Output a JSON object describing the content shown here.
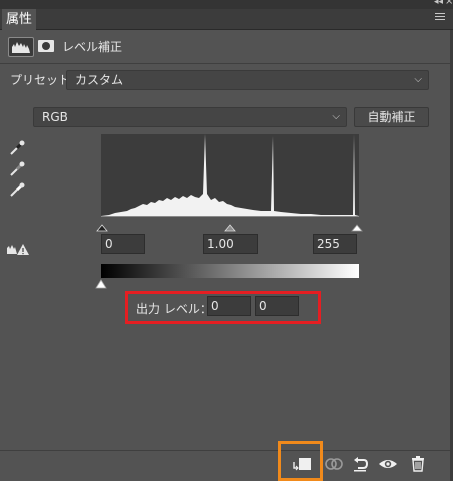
{
  "panel": {
    "tab_label": "属性",
    "title": "レベル補正"
  },
  "preset": {
    "label": "プリセット：",
    "value": "カスタム"
  },
  "channel": {
    "value": "RGB",
    "auto_button": "自動補正"
  },
  "input_levels": {
    "black": "0",
    "gamma": "1.00",
    "white": "255"
  },
  "output_levels": {
    "label": "出力 レベル：",
    "black": "0",
    "white": "0"
  },
  "icons": {
    "header": [
      "histogram-icon",
      "mask-icon"
    ],
    "eyedroppers": [
      "black-point-eyedropper-icon",
      "gray-point-eyedropper-icon",
      "white-point-eyedropper-icon"
    ],
    "bottom": [
      "clip-to-layer-icon",
      "view-previous-state-icon",
      "reset-icon",
      "visibility-eye-icon",
      "trash-icon"
    ]
  },
  "colors": {
    "panel_bg": "#535353",
    "highlight_red": "#e51e22",
    "highlight_orange": "#f18a1b"
  }
}
